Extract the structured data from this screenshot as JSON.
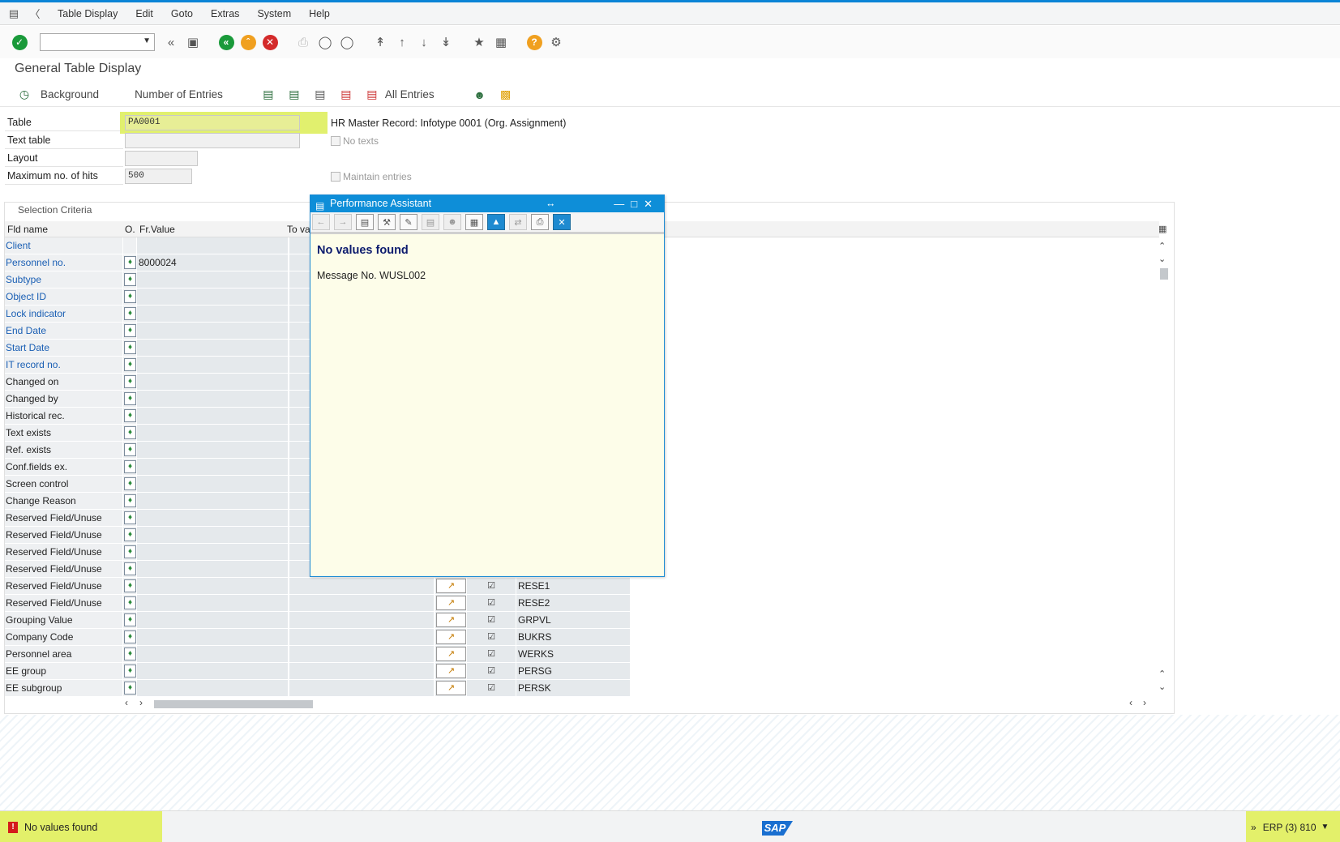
{
  "menu": [
    "Table Display",
    "Edit",
    "Goto",
    "Extras",
    "System",
    "Help"
  ],
  "page_title": "General Table Display",
  "app_toolbar": {
    "background_label": "Background",
    "entries_label": "Number of Entries",
    "all_entries_label": "All Entries"
  },
  "form": {
    "table_label": "Table",
    "table_value": "PA0001",
    "table_desc": "HR Master Record: Infotype 0001 (Org. Assignment)",
    "text_table_label": "Text table",
    "no_texts_label": "No texts",
    "layout_label": "Layout",
    "max_hits_label": "Maximum no. of hits",
    "max_hits_value": "500",
    "maintain_label": "Maintain entries"
  },
  "selection": {
    "header": "Selection Criteria",
    "col_field": "Fld name",
    "col_op": "O.",
    "col_from": "Fr.Value",
    "col_to": "To va",
    "rows": [
      {
        "name": "Client",
        "blue": true,
        "op": false,
        "from": "",
        "fld": ""
      },
      {
        "name": "Personnel no.",
        "blue": true,
        "op": true,
        "from": "8000024",
        "fld": "",
        "hl": true
      },
      {
        "name": "Subtype",
        "blue": true,
        "op": true,
        "from": "",
        "fld": ""
      },
      {
        "name": "Object ID",
        "blue": true,
        "op": true,
        "from": "",
        "fld": ""
      },
      {
        "name": "Lock indicator",
        "blue": true,
        "op": true,
        "from": "",
        "fld": ""
      },
      {
        "name": "End Date",
        "blue": true,
        "op": true,
        "from": "",
        "fld": ""
      },
      {
        "name": "Start Date",
        "blue": true,
        "op": true,
        "from": "",
        "fld": ""
      },
      {
        "name": "IT record no.",
        "blue": true,
        "op": true,
        "from": "",
        "fld": ""
      },
      {
        "name": "Changed on",
        "blue": false,
        "op": true,
        "from": "",
        "fld": ""
      },
      {
        "name": "Changed by",
        "blue": false,
        "op": true,
        "from": "",
        "fld": ""
      },
      {
        "name": "Historical rec.",
        "blue": false,
        "op": true,
        "from": "",
        "fld": ""
      },
      {
        "name": "Text exists",
        "blue": false,
        "op": true,
        "from": "",
        "fld": ""
      },
      {
        "name": "Ref. exists",
        "blue": false,
        "op": true,
        "from": "",
        "fld": ""
      },
      {
        "name": "Conf.fields ex.",
        "blue": false,
        "op": true,
        "from": "",
        "fld": ""
      },
      {
        "name": "Screen control",
        "blue": false,
        "op": true,
        "from": "",
        "fld": ""
      },
      {
        "name": "Change Reason",
        "blue": false,
        "op": true,
        "from": "",
        "fld": ""
      },
      {
        "name": "Reserved Field/Unuse",
        "blue": false,
        "op": true,
        "from": "",
        "fld": ""
      },
      {
        "name": "Reserved Field/Unuse",
        "blue": false,
        "op": true,
        "from": "",
        "fld": ""
      },
      {
        "name": "Reserved Field/Unuse",
        "blue": false,
        "op": true,
        "from": "",
        "fld": ""
      },
      {
        "name": "Reserved Field/Unuse",
        "blue": false,
        "op": true,
        "from": "",
        "fld": ""
      },
      {
        "name": "Reserved Field/Unuse",
        "blue": false,
        "op": true,
        "from": "",
        "fld": "RESE1",
        "more": true
      },
      {
        "name": "Reserved Field/Unuse",
        "blue": false,
        "op": true,
        "from": "",
        "fld": "RESE2",
        "more": true
      },
      {
        "name": "Grouping Value",
        "blue": false,
        "op": true,
        "from": "",
        "fld": "GRPVL",
        "more": true
      },
      {
        "name": "Company Code",
        "blue": false,
        "op": true,
        "from": "",
        "fld": "BUKRS",
        "more": true
      },
      {
        "name": "Personnel area",
        "blue": false,
        "op": true,
        "from": "",
        "fld": "WERKS",
        "more": true
      },
      {
        "name": "EE group",
        "blue": false,
        "op": true,
        "from": "",
        "fld": "PERSG",
        "more": true
      },
      {
        "name": "EE subgroup",
        "blue": false,
        "op": true,
        "from": "",
        "fld": "PERSK",
        "more": true
      }
    ]
  },
  "dialog": {
    "title": "Performance Assistant",
    "message": "No values found",
    "message_no": "Message No. WUSL002"
  },
  "status": {
    "message": "No values found",
    "system": "ERP (3) 810",
    "logo": "SAP"
  },
  "colors": {
    "accent": "#0e8ed8",
    "highlight": "#e1f06e",
    "field_blue": "#1a5fb4"
  }
}
